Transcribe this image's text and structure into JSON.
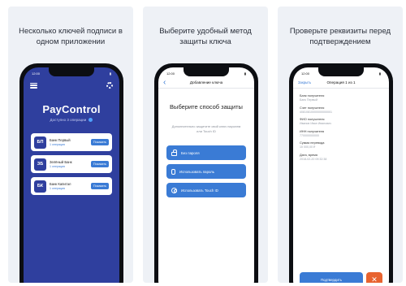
{
  "panels": [
    {
      "caption": "Несколько ключей подписи в одном приложении"
    },
    {
      "caption": "Выберите удобный метод защиты ключа"
    },
    {
      "caption": "Проверьте реквизиты перед подтверждением"
    }
  ],
  "status_time": "12:00",
  "screen1": {
    "title": "PayControl",
    "subtitle": "Доступно 3 операции",
    "banks": [
      {
        "logo": "БП",
        "name": "Банк Первый",
        "meta": "1 операция",
        "button": "Показать"
      },
      {
        "logo": "ЗБ",
        "name": "Зелёный Банк",
        "meta": "1 операция",
        "button": "Показать"
      },
      {
        "logo": "БК",
        "name": "Банк Капитал",
        "meta": "1 операция",
        "button": "Показать"
      }
    ]
  },
  "screen2": {
    "nav_title": "Добавление ключа",
    "title": "Выберите способ защиты",
    "description": "Дополнительно защитите свой ключ паролем или Touch ID",
    "methods": [
      {
        "icon": "lock-open-icon",
        "label": "Без пароля"
      },
      {
        "icon": "password-icon",
        "label": "Использовать пароль"
      },
      {
        "icon": "fingerprint-icon",
        "label": "Использовать Touch ID"
      }
    ]
  },
  "screen3": {
    "back_label": "Закрыть",
    "nav_title": "Операция 1 из 1",
    "details": [
      {
        "label": "Банк получателя",
        "value": "Банк Первый"
      },
      {
        "label": "Счет получателя",
        "value": "40810810000000000001"
      },
      {
        "label": "ФИО получателя",
        "value": "Иванов Иван Иванович"
      },
      {
        "label": "ИНН получателя",
        "value": "770000000000"
      },
      {
        "label": "Сумма перевода",
        "value": "10 000,00 ₽"
      },
      {
        "label": "Дата, время",
        "value": "2018-02-20 09:32:38"
      }
    ],
    "confirm_button": "Подтвердить",
    "cancel_button": "✕"
  },
  "colors": {
    "primary_blue": "#3a7bd5",
    "header_indigo": "#2f3f9e",
    "cancel_orange": "#e8632f",
    "panel_bg": "#eef1f6"
  }
}
